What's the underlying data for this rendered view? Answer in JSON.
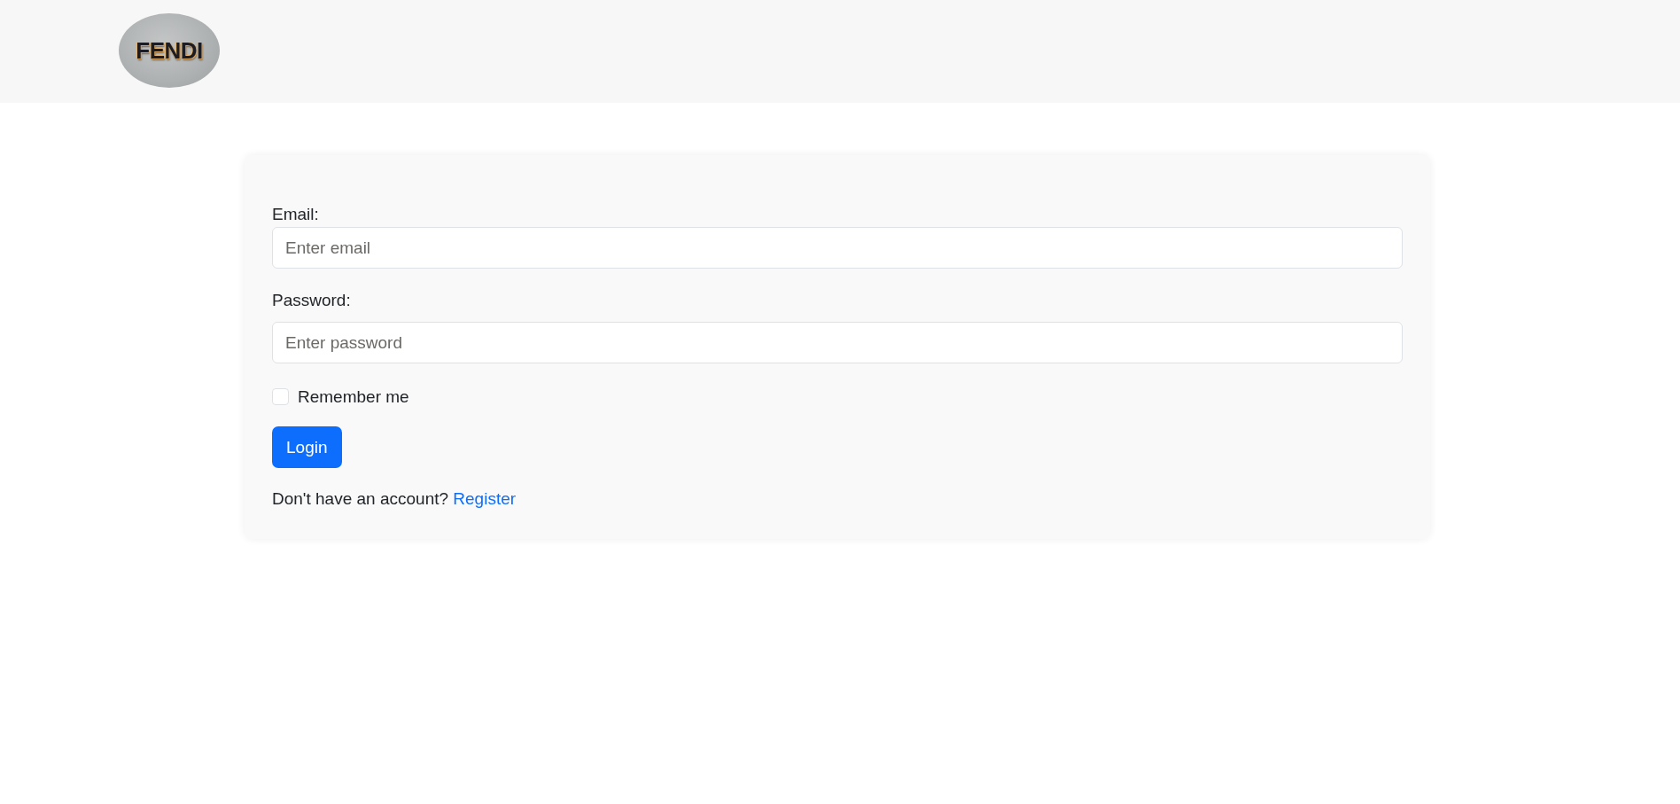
{
  "header": {
    "logo": "FENDI"
  },
  "login_form": {
    "fields": [
      {
        "label": "Email:",
        "placeholder": "Enter email"
      },
      {
        "label": "Password:",
        "placeholder": "Enter password"
      }
    ],
    "remember": {
      "label": "Remember me",
      "checked": false
    },
    "submit": "Login",
    "footer": {
      "prompt": "Don't have an account?",
      "link": "Register"
    }
  }
}
